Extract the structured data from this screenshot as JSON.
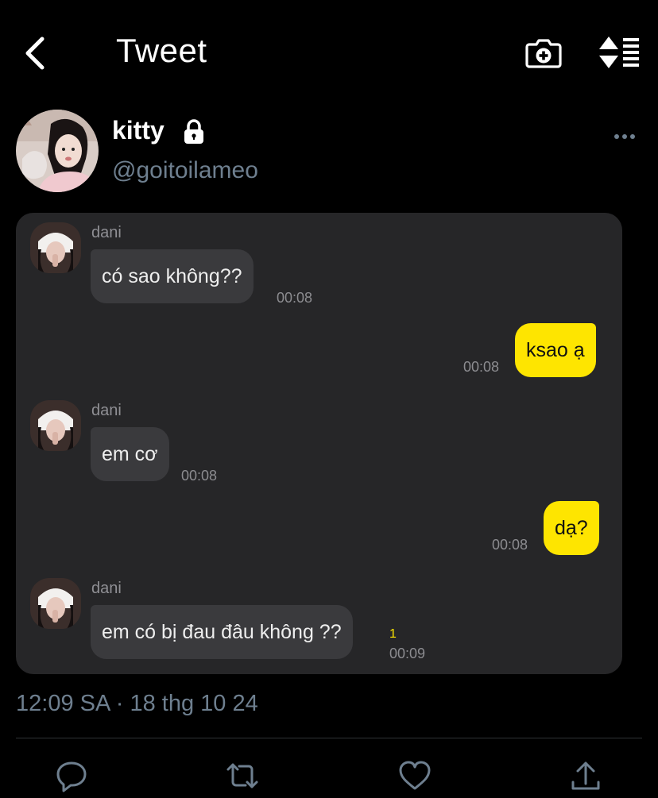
{
  "header": {
    "title": "Tweet"
  },
  "author": {
    "display_name": "kitty",
    "handle": "@goitoilameo"
  },
  "chat": {
    "messages": [
      {
        "sender": "dani",
        "text": "có sao không??",
        "time": "00:08"
      },
      {
        "self": true,
        "text": "ksao ạ",
        "time": "00:08"
      },
      {
        "sender": "dani",
        "text": "em cơ",
        "time": "00:08"
      },
      {
        "self": true,
        "text": "dạ?",
        "time": "00:08"
      },
      {
        "sender": "dani",
        "text": "em có bị đau đâu không ??",
        "time": "00:09",
        "unread": "1"
      }
    ]
  },
  "tweet": {
    "timestamp": "12:09 SA · 18 thg 10 24"
  },
  "icons": {
    "back": "chevron-left-icon",
    "camera": "camera-plus-icon",
    "sort": "sort-icon",
    "lock": "lock-icon",
    "more": "more-dots-icon",
    "reply": "reply-icon",
    "retweet": "retweet-icon",
    "like": "heart-icon",
    "share": "share-icon"
  },
  "colors": {
    "background": "#000000",
    "card": "#262628",
    "bubble_self": "#fee500",
    "bubble_other": "#3a3a3d",
    "muted": "#6e7f8f"
  }
}
